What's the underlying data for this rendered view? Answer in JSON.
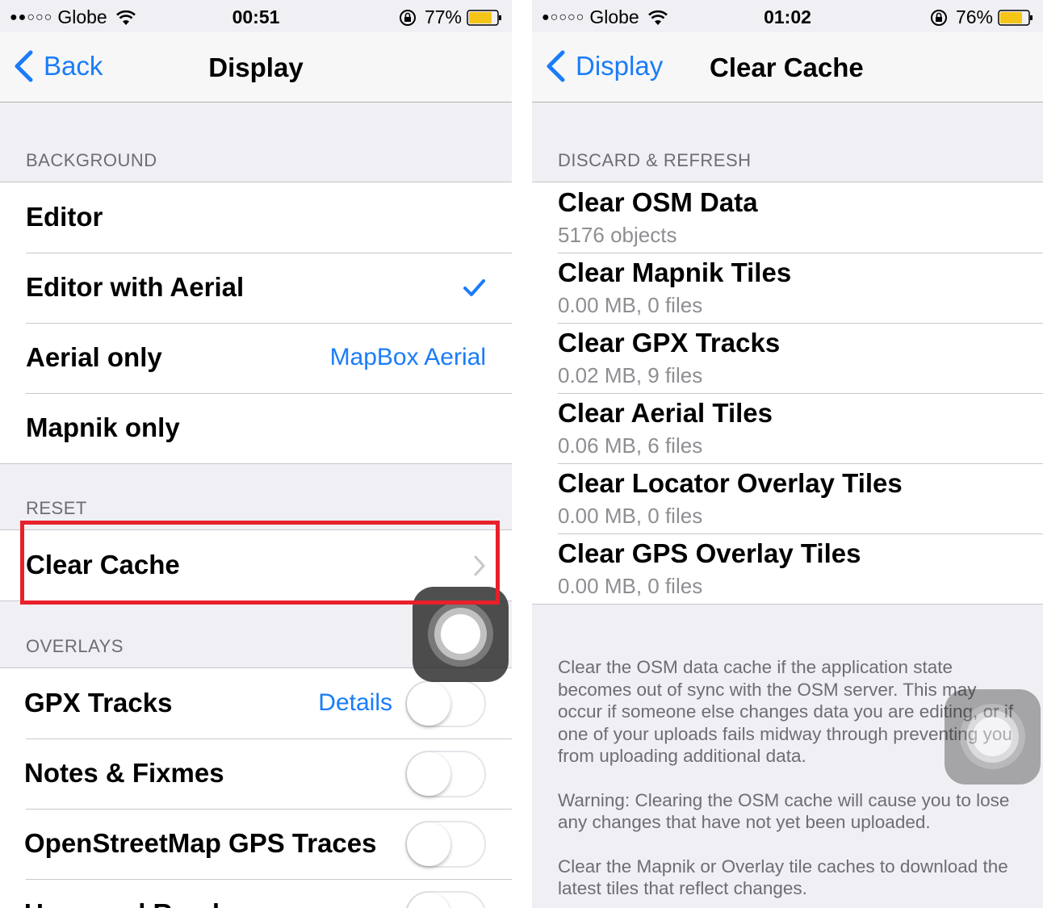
{
  "left": {
    "status": {
      "carrier": "Globe",
      "time": "00:51",
      "battery": "77%"
    },
    "nav": {
      "back_label": "Back",
      "title": "Display"
    },
    "background": {
      "header": "BACKGROUND",
      "items": [
        {
          "label": "Editor"
        },
        {
          "label": "Editor with Aerial",
          "checked": true
        },
        {
          "label": "Aerial only",
          "detail": "MapBox Aerial"
        },
        {
          "label": "Mapnik only"
        }
      ]
    },
    "reset": {
      "header": "RESET",
      "clear_cache_label": "Clear Cache"
    },
    "overlays": {
      "header": "OVERLAYS",
      "items": [
        {
          "label": "GPX Tracks",
          "detail": "Details",
          "on": false
        },
        {
          "label": "Notes & Fixmes",
          "on": false
        },
        {
          "label": "OpenStreetMap GPS Traces",
          "on": false
        },
        {
          "label": "Unnamed Roads",
          "on": false
        }
      ]
    }
  },
  "right": {
    "status": {
      "carrier": "Globe",
      "time": "01:02",
      "battery": "76%"
    },
    "nav": {
      "back_label": "Display",
      "title": "Clear Cache"
    },
    "discard": {
      "header": "DISCARD & REFRESH",
      "items": [
        {
          "label": "Clear OSM Data",
          "sub": "5176 objects"
        },
        {
          "label": "Clear Mapnik Tiles",
          "sub": "0.00 MB, 0 files"
        },
        {
          "label": "Clear GPX Tracks",
          "sub": "0.02 MB, 9 files"
        },
        {
          "label": "Clear Aerial Tiles",
          "sub": "0.06 MB, 6 files"
        },
        {
          "label": "Clear Locator Overlay Tiles",
          "sub": "0.00 MB, 0 files"
        },
        {
          "label": "Clear GPS Overlay Tiles",
          "sub": "0.00 MB, 0 files"
        }
      ]
    },
    "footer": {
      "p1": "Clear the OSM data cache if the application state becomes out of sync with the OSM server. This may occur if someone else changes data you are editing, or if one of your uploads fails midway through preventing you from uploading additional data.",
      "p2": "Warning: Clearing the OSM cache will cause you to lose any changes that have not yet been uploaded.",
      "p3": "Clear the Mapnik or Overlay tile caches  to download the latest tiles that reflect changes."
    }
  },
  "colors": {
    "ios_blue": "#1a7cf9",
    "battery_yellow": "#f5c518",
    "highlight_red": "#e8202a"
  }
}
